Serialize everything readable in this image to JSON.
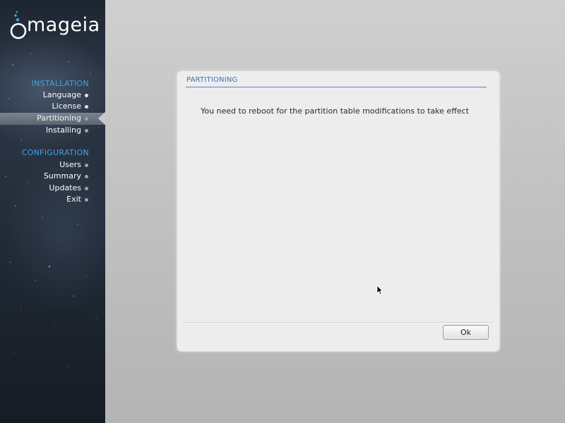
{
  "sidebar": {
    "logo_text": "mageia",
    "sections": [
      {
        "heading": "INSTALLATION",
        "items": [
          {
            "label": "Language",
            "state": "done"
          },
          {
            "label": "License",
            "state": "done"
          },
          {
            "label": "Partitioning",
            "state": "active"
          },
          {
            "label": "Installing",
            "state": "pending"
          }
        ]
      },
      {
        "heading": "CONFIGURATION",
        "items": [
          {
            "label": "Users",
            "state": "pending"
          },
          {
            "label": "Summary",
            "state": "pending"
          },
          {
            "label": "Updates",
            "state": "pending"
          },
          {
            "label": "Exit",
            "state": "pending"
          }
        ]
      }
    ]
  },
  "dialog": {
    "title": "PARTITIONING",
    "message": "You need to reboot for the partition table modifications to take effect",
    "ok_label": "Ok"
  },
  "colors": {
    "section_heading": "#3fa6e0",
    "dialog_title": "#3d6fc0",
    "sidebar_bg": "#27313f"
  },
  "icons": {
    "logo": "mageia-logo-icon",
    "cursor": "mouse-pointer-icon"
  }
}
